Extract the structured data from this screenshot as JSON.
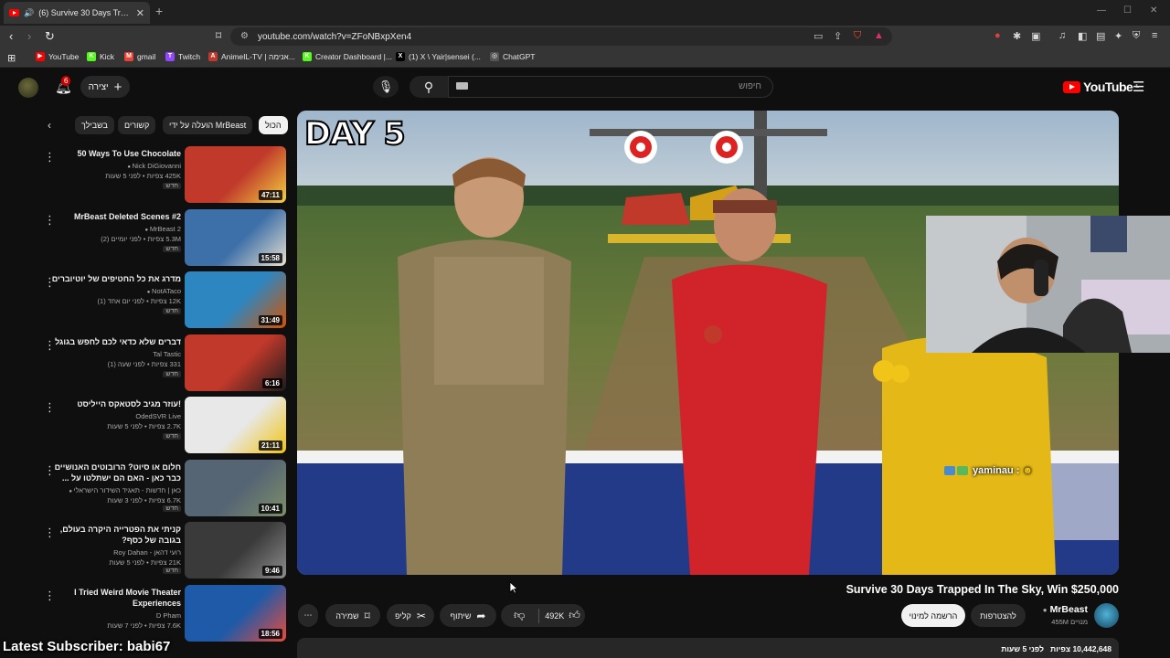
{
  "browser": {
    "tab_title": "(6) Survive 30 Days Trapped In...",
    "new_tab": "+",
    "url": "youtube.com/watch?v=ZFoNBxpXen4"
  },
  "bookmarks": [
    {
      "label": "YouTube",
      "color": "#ff0000",
      "glyph": "▶"
    },
    {
      "label": "Kick",
      "color": "#53fc18",
      "glyph": "K"
    },
    {
      "label": "gmail",
      "color": "#ea4335",
      "glyph": "M"
    },
    {
      "label": "Twitch",
      "color": "#9146ff",
      "glyph": "T"
    },
    {
      "label": "AnimeIL-TV | אנימה...",
      "color": "#c0392b",
      "glyph": "A"
    },
    {
      "label": "Creator Dashboard |...",
      "color": "#53fc18",
      "glyph": "K"
    },
    {
      "label": "(1) X \\ Yair|sensei (...",
      "color": "#000000",
      "glyph": "X"
    },
    {
      "label": "ChatGPT",
      "color": "#555555",
      "glyph": "◎"
    }
  ],
  "header": {
    "notification_count": "6",
    "create_label": "יצירה",
    "search_placeholder": "חיפוש",
    "logo_text": "YouTube",
    "logo_sup": "IL"
  },
  "chips": [
    {
      "label": "הכול",
      "active": true
    },
    {
      "label": "הועלה על ידי MrBeast",
      "active": false
    },
    {
      "label": "קשורים",
      "active": false
    },
    {
      "label": "בשבילך",
      "active": false
    }
  ],
  "recommendations": [
    {
      "title": "50 Ways To Use Chocolate",
      "channel": "Nick DiGiovanni",
      "verified": true,
      "stats": "425K צפיות • לפני 5 שעות",
      "new": "חדש",
      "duration": "47:11"
    },
    {
      "title": "MrBeast Deleted Scenes #2",
      "channel": "MrBeast 2",
      "verified": true,
      "stats": "5.3M צפיות • לפני יומיים (2)",
      "new": "חדש",
      "duration": "15:58"
    },
    {
      "title": "מדרג את כל החטיפים של יוטיוברים",
      "channel": "NotATaco",
      "verified": true,
      "stats": "12K צפיות • לפני יום אחד (1)",
      "new": "חדש",
      "duration": "31:49"
    },
    {
      "title": "דברים שלא כדאי לכם לחפש בגוגל",
      "channel": "Tal Tastic",
      "verified": false,
      "stats": "331 צפיות • לפני שעה (1)",
      "new": "חדש",
      "duration": "6:16"
    },
    {
      "title": "!עוזר מגיב לסטאקס הייליסט",
      "channel": "OdedSVR Live",
      "verified": false,
      "stats": "2.7K צפיות • לפני 5 שעות",
      "new": "חדש",
      "duration": "21:11"
    },
    {
      "title": "חלום או סיוט? הרובוטים האנושיים כבר כאן - האם הם ישתלטו על ...",
      "channel": "כאן | חדשות - תאגיד השידור הישראלי",
      "verified": true,
      "stats": "6.7K צפיות • לפני 3 שעות",
      "new": "חדש",
      "duration": "10:41"
    },
    {
      "title": "קניתי את הפטרייה היקרה בעולם, בגובה של כסף?",
      "channel": "Roy Dahan - רועי דהאן",
      "verified": false,
      "stats": "21K צפיות • לפני 5 שעות",
      "new": "חדש",
      "duration": "9:46"
    },
    {
      "title": "I Tried Weird Movie Theater Experiences",
      "channel": "D Pham",
      "verified": false,
      "stats": "7.6K צפיות • לפני 7 שעות",
      "new": "",
      "duration": "18:56"
    }
  ],
  "player": {
    "overlay_text": "DAY 5",
    "chat_user": "yaminau :"
  },
  "video": {
    "title": "Survive 30 Days Trapped In The Sky, Win $250,000",
    "channel": "MrBeast",
    "subscribers": "455M מנויים",
    "join_label": "להצטרפות",
    "subscribe_label": "הרשמה למינוי",
    "likes": "492K",
    "share_label": "שיתוף",
    "clip_label": "קליפ",
    "save_label": "שמירה",
    "views": "10,442,648 צפיות",
    "age": "לפני 5 שעות"
  },
  "stream_overlay": {
    "latest_subscriber": "Latest Subscriber: babi67"
  },
  "colors": {
    "background": "#0f0f0f",
    "brand_red": "#ff0000",
    "chip_bg": "#272727"
  }
}
